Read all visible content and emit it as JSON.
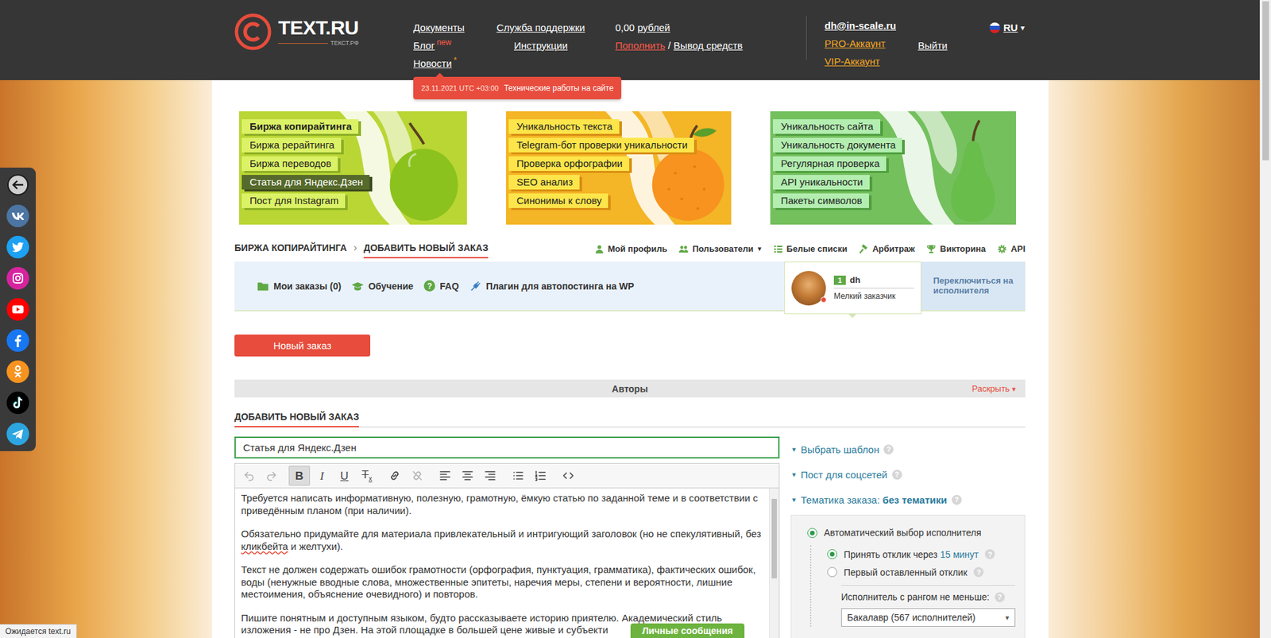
{
  "logo": {
    "name": "TEXT.RU",
    "sub": "ТЕКСТ.РФ"
  },
  "header": {
    "nav": [
      [
        {
          "label": "Документы",
          "badge": "",
          "badge_color": ""
        },
        {
          "label": "Блог",
          "badge": "new",
          "badge_color": "#ff5a4a"
        },
        {
          "label": "Новости",
          "badge": "*",
          "badge_color": "#f39c12"
        }
      ],
      [
        {
          "label": "Служба поддержки",
          "badge": "",
          "badge_color": ""
        },
        {
          "label": "Инструкции",
          "badge": "",
          "badge_color": ""
        }
      ]
    ],
    "balance": {
      "amount": "0,00",
      "currency": "рублей"
    },
    "topup": "Пополнить",
    "slash": "/",
    "withdraw": "Вывод средств",
    "account": {
      "email": "dh@in-scale.ru",
      "pro": "PRO-Аккаунт",
      "vip": "VIP-Аккаунт"
    },
    "logout": "Выйти",
    "language": {
      "code": "RU",
      "arrow": "▾"
    }
  },
  "notice": {
    "time": "23.11.2021 UTC +03:00",
    "text": "Технические работы на сайте"
  },
  "social": [
    {
      "kind": "back",
      "color": "#1a1a1a"
    },
    {
      "kind": "vk",
      "color": "#4c75a3"
    },
    {
      "kind": "twitter",
      "color": "#1da1f2"
    },
    {
      "kind": "instagram",
      "color": "#d6249f"
    },
    {
      "kind": "youtube",
      "color": "#ff0000"
    },
    {
      "kind": "facebook",
      "color": "#1877f2"
    },
    {
      "kind": "ok",
      "color": "#f7931e"
    },
    {
      "kind": "tiktok",
      "color": "#010101"
    },
    {
      "kind": "telegram",
      "color": "#2ca5e0"
    }
  ],
  "banners": [
    {
      "kind": "apple",
      "color": "#b9d635",
      "label_color": "#dcf266",
      "shadow_color": "#8cae23",
      "fruit_color": "#8cc21d",
      "items": [
        {
          "label": "Биржа копирайтинга",
          "current": true,
          "selected": false
        },
        {
          "label": "Биржа рерайтинга",
          "current": false,
          "selected": false
        },
        {
          "label": "Биржа переводов",
          "current": false,
          "selected": false
        },
        {
          "label": "Статья для Яндекс.Дзен",
          "current": false,
          "selected": true
        },
        {
          "label": "Пост для Instagram",
          "current": false,
          "selected": false
        }
      ]
    },
    {
      "kind": "orange",
      "color": "#f4b526",
      "label_color": "#fde54a",
      "shadow_color": "#d98e12",
      "fruit_color": "#f7931e",
      "items": [
        {
          "label": "Уникальность текста",
          "current": false,
          "selected": false
        },
        {
          "label": "Telegram-бот проверки уникальности",
          "current": false,
          "selected": false
        },
        {
          "label": "Проверка орфографии",
          "current": false,
          "selected": false
        },
        {
          "label": "SEO анализ",
          "current": false,
          "selected": false
        },
        {
          "label": "Синонимы к слову",
          "current": false,
          "selected": false
        }
      ]
    },
    {
      "kind": "pear",
      "color": "#74c05d",
      "label_color": "#b3eeb0",
      "shadow_color": "#4f9e3f",
      "fruit_color": "#69bd4a",
      "items": [
        {
          "label": "Уникальность сайта",
          "current": false,
          "selected": false
        },
        {
          "label": "Уникальность документа",
          "current": false,
          "selected": false
        },
        {
          "label": "Регулярная проверка",
          "current": false,
          "selected": false
        },
        {
          "label": "API уникальности",
          "current": false,
          "selected": false
        },
        {
          "label": "Пакеты символов",
          "current": false,
          "selected": false
        }
      ]
    }
  ],
  "breadcrumbs": {
    "separator": "›",
    "items": [
      {
        "label": "БИРЖА КОПИРАЙТИНГА",
        "selected": false
      },
      {
        "label": "ДОБАВИТЬ НОВЫЙ ЗАКАЗ",
        "selected": true
      }
    ]
  },
  "menu": {
    "arrow": "▾",
    "items": [
      {
        "label": "Мой профиль",
        "kind": "profile",
        "dropdown": false
      },
      {
        "label": "Пользователи",
        "kind": "users",
        "dropdown": true
      },
      {
        "label": "Белые списки",
        "kind": "list",
        "dropdown": false
      },
      {
        "label": "Арбитраж",
        "kind": "gavel",
        "dropdown": false
      },
      {
        "label": "Викторина",
        "kind": "trophy",
        "dropdown": false
      },
      {
        "label": "API",
        "kind": "gear",
        "dropdown": false
      }
    ]
  },
  "subnav": [
    {
      "label": "Мои заказы (0)",
      "kind": "folder"
    },
    {
      "label": "Обучение",
      "kind": "cap"
    },
    {
      "label": "FAQ",
      "kind": "help"
    },
    {
      "label": "Плагин для автопостинга на WP",
      "kind": "plug"
    }
  ],
  "user": {
    "rank": "1",
    "name": "dh",
    "role": "Мелкий заказчик"
  },
  "switch_role": "Переключиться на исполнителя",
  "new_order": "Новый заказ",
  "authors": {
    "title": "Авторы",
    "toggle": "Раскрыть",
    "arrow": "▾"
  },
  "form": {
    "heading": "ДОБАВИТЬ НОВЫЙ ЗАКАЗ",
    "title_value": "Статья для Яндекс.Дзен",
    "toolbar": [
      [
        {
          "kind": "undo",
          "label": "",
          "sub": "",
          "active": false,
          "disabled": true
        },
        {
          "kind": "redo",
          "label": "",
          "sub": "",
          "active": false,
          "disabled": true
        }
      ],
      [
        {
          "kind": "bold",
          "label": "B",
          "sub": "",
          "active": true,
          "disabled": false
        },
        {
          "kind": "italic",
          "label": "I",
          "sub": "",
          "active": false,
          "disabled": false
        },
        {
          "kind": "underline",
          "label": "U",
          "sub": "",
          "active": false,
          "disabled": false
        },
        {
          "kind": "clear",
          "label": "T",
          "sub": "x",
          "active": false,
          "disabled": false
        }
      ],
      [
        {
          "kind": "link",
          "label": "",
          "sub": "",
          "active": false,
          "disabled": false
        },
        {
          "kind": "unlink",
          "label": "",
          "sub": "",
          "active": false,
          "disabled": true
        }
      ],
      [
        {
          "kind": "align-left",
          "label": "",
          "sub": "",
          "active": false,
          "disabled": false
        },
        {
          "kind": "align-center",
          "label": "",
          "sub": "",
          "active": false,
          "disabled": false
        },
        {
          "kind": "align-right",
          "label": "",
          "sub": "",
          "active": false,
          "disabled": false
        }
      ],
      [
        {
          "kind": "list-ul",
          "label": "",
          "sub": "",
          "active": false,
          "disabled": false
        },
        {
          "kind": "list-ol",
          "label": "",
          "sub": "",
          "active": false,
          "disabled": false
        }
      ],
      [
        {
          "kind": "code",
          "label": "",
          "sub": "",
          "active": false,
          "disabled": false
        }
      ]
    ],
    "paragraphs": [
      [
        {
          "text": "Требуется написать информативную, полезную, грамотную, ёмкую статью по заданной теме и в соответствии с приведённым планом (при наличии).",
          "misspelled": false
        }
      ],
      [
        {
          "text": "Обязательно придумайте для материала привлекательный и интригующий заголовок (но не спекулятивный, без ",
          "misspelled": false
        },
        {
          "text": "кликбейта",
          "misspelled": true
        },
        {
          "text": " и желтухи).",
          "misspelled": false
        }
      ],
      [
        {
          "text": "Текст не должен содержать ошибок грамотности (орфография, пунктуация, грамматика), фактических ошибок, воды (ненужные вводные слова, множественные эпитеты, наречия меры, степени и вероятности, лишние местоимения, объяснение очевидного) и повторов.",
          "misspelled": false
        }
      ],
      [
        {
          "text": "Пишите понятным и доступным языком, будто рассказываете историю приятелю. Академический стиль изложения - не про Дзен. На этой площадке в большей цене живые и субъекти",
          "misspelled": false
        }
      ]
    ]
  },
  "options": {
    "arrow": "▾",
    "items": [
      {
        "label": "Выбрать шаблон",
        "value": ""
      },
      {
        "label": "Пост для соцсетей",
        "value": ""
      },
      {
        "label": "Тематика заказа:",
        "value": "без тематики"
      }
    ]
  },
  "help": "?",
  "executor": {
    "modes": [
      {
        "label": "Автоматический выбор исполнителя",
        "selected": true
      }
    ],
    "accept": [
      {
        "label": "Принять отклик через",
        "link": "15 минут",
        "selected": true
      },
      {
        "label": "Первый оставленный отклик",
        "link": "",
        "selected": false
      }
    ],
    "rank_label": "Исполнитель с рангом не меньше:",
    "rank_value": "Бакалавр (567 исполнителей)",
    "rank_arrow": "▾"
  },
  "messages": "Личные сообщения",
  "status": "Ожидается text.ru"
}
